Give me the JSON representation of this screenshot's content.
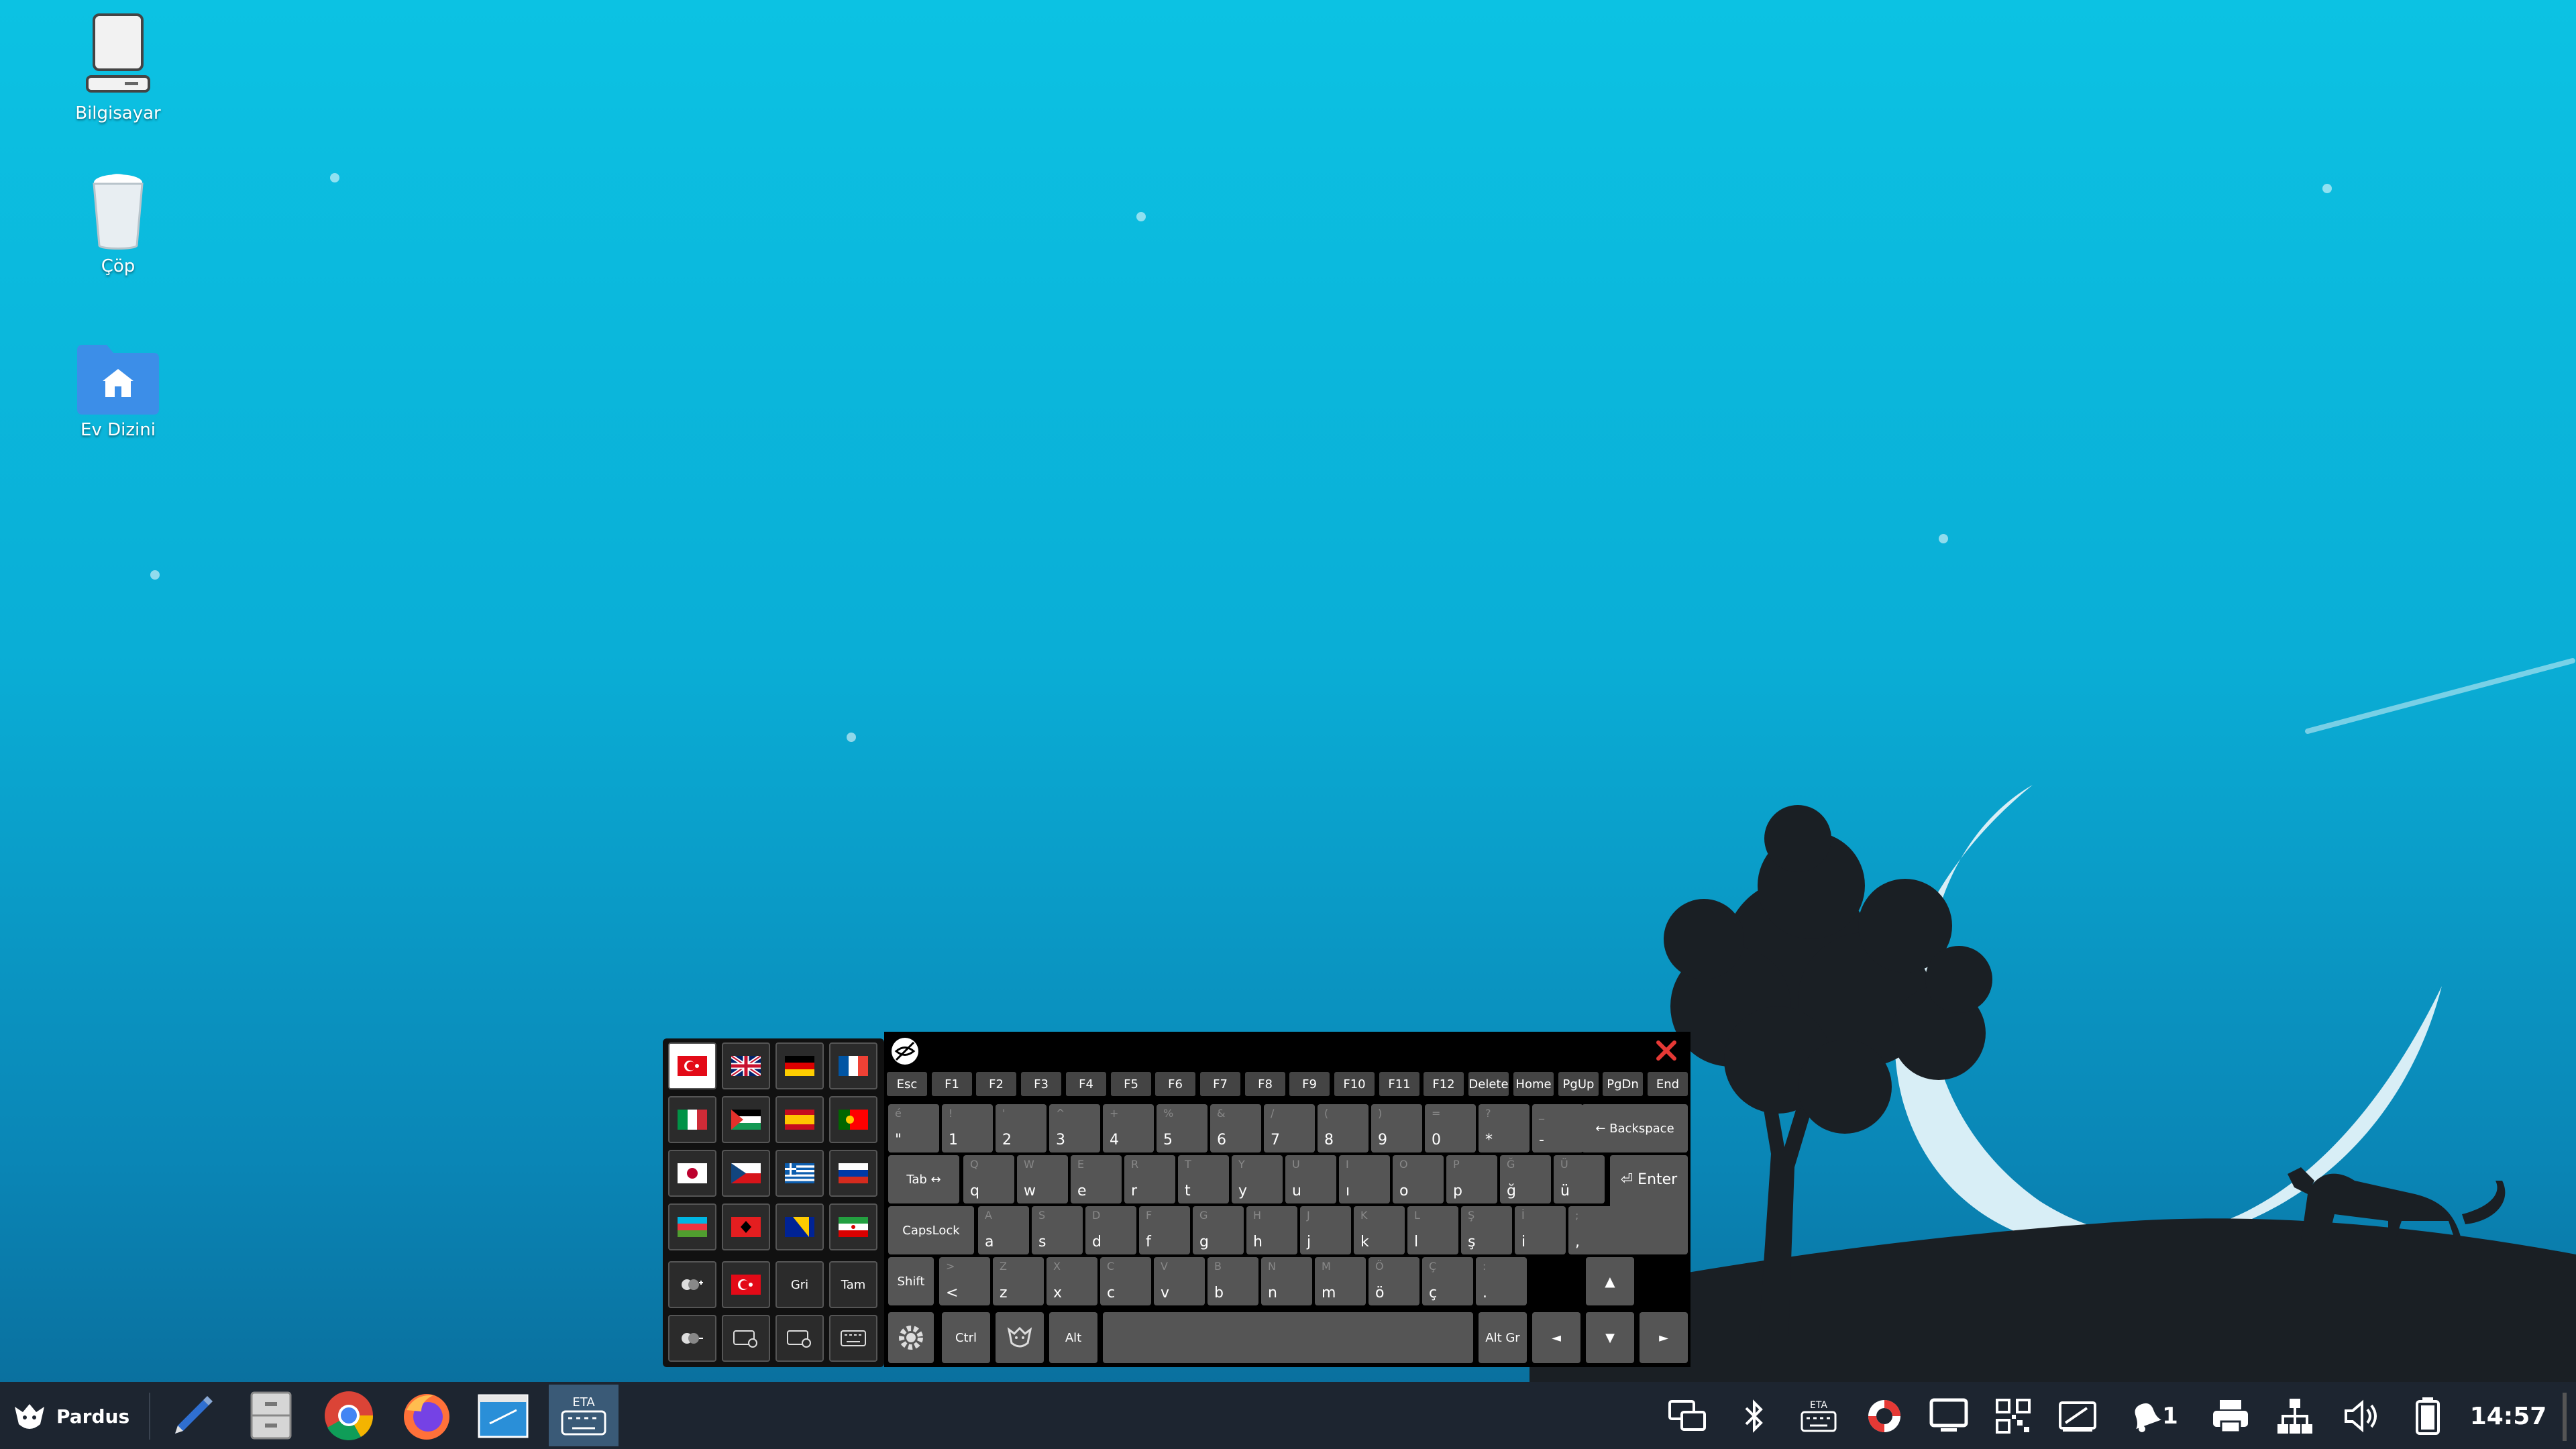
{
  "desktop": {
    "icons": [
      {
        "label": "Bilgisayar"
      },
      {
        "label": "Çöp"
      },
      {
        "label": "Ev Dizini"
      }
    ]
  },
  "keyboard": {
    "function_keys": [
      "Esc",
      "F1",
      "F2",
      "F3",
      "F4",
      "F5",
      "F6",
      "F7",
      "F8",
      "F9",
      "F10",
      "F11",
      "F12",
      "Delete",
      "Home",
      "PgUp",
      "PgDn",
      "End"
    ],
    "row1": [
      {
        "main": "\"",
        "alt": "é"
      },
      {
        "main": "1",
        "alt": "!"
      },
      {
        "main": "2",
        "alt": "'"
      },
      {
        "main": "3",
        "alt": "^"
      },
      {
        "main": "4",
        "alt": "+"
      },
      {
        "main": "5",
        "alt": "%"
      },
      {
        "main": "6",
        "alt": "&"
      },
      {
        "main": "7",
        "alt": "/"
      },
      {
        "main": "8",
        "alt": "("
      },
      {
        "main": "9",
        "alt": ")"
      },
      {
        "main": "0",
        "alt": "="
      },
      {
        "main": "*",
        "alt": "?"
      },
      {
        "main": "-",
        "alt": "_"
      }
    ],
    "row2": [
      {
        "main": "q",
        "alt": "Q"
      },
      {
        "main": "w",
        "alt": "W"
      },
      {
        "main": "e",
        "alt": "E"
      },
      {
        "main": "r",
        "alt": "R"
      },
      {
        "main": "t",
        "alt": "T"
      },
      {
        "main": "y",
        "alt": "Y"
      },
      {
        "main": "u",
        "alt": "U"
      },
      {
        "main": "ı",
        "alt": "I"
      },
      {
        "main": "o",
        "alt": "O"
      },
      {
        "main": "p",
        "alt": "P"
      },
      {
        "main": "ğ",
        "alt": "Ğ"
      },
      {
        "main": "ü",
        "alt": "Ü"
      }
    ],
    "row3": [
      {
        "main": "a",
        "alt": "A"
      },
      {
        "main": "s",
        "alt": "S"
      },
      {
        "main": "d",
        "alt": "D"
      },
      {
        "main": "f",
        "alt": "F"
      },
      {
        "main": "g",
        "alt": "G"
      },
      {
        "main": "h",
        "alt": "H"
      },
      {
        "main": "j",
        "alt": "J"
      },
      {
        "main": "k",
        "alt": "K"
      },
      {
        "main": "l",
        "alt": "L"
      },
      {
        "main": "ş",
        "alt": "Ş"
      },
      {
        "main": "i",
        "alt": "İ"
      },
      {
        "main": ",",
        "alt": ";"
      }
    ],
    "row4": [
      {
        "main": "<",
        "alt": ">"
      },
      {
        "main": "z",
        "alt": "Z"
      },
      {
        "main": "x",
        "alt": "X"
      },
      {
        "main": "c",
        "alt": "C"
      },
      {
        "main": "v",
        "alt": "V"
      },
      {
        "main": "b",
        "alt": "B"
      },
      {
        "main": "n",
        "alt": "N"
      },
      {
        "main": "m",
        "alt": "M"
      },
      {
        "main": "ö",
        "alt": "Ö"
      },
      {
        "main": "ç",
        "alt": "Ç"
      },
      {
        "main": ".",
        "alt": ":"
      }
    ],
    "labels": {
      "backspace": "← Backspace",
      "tab": "Tab ↔",
      "enter": "⏎ Enter",
      "capslock": "CapsLock",
      "shift": "Shift",
      "ctrl": "Ctrl",
      "alt": "Alt",
      "altgr": "Alt Gr",
      "up": "▲",
      "down": "▼",
      "left": "◄",
      "right": "►",
      "gri": "Gri",
      "tam": "Tam"
    }
  },
  "taskbar": {
    "start_label": "Pardus",
    "eta_label": "ETA",
    "tray_eta_label": "ETA",
    "notifications_count": "1",
    "clock": "14:57"
  },
  "colors": {
    "accent_close": "#e53935",
    "taskbar_bg": "#1d2530"
  }
}
